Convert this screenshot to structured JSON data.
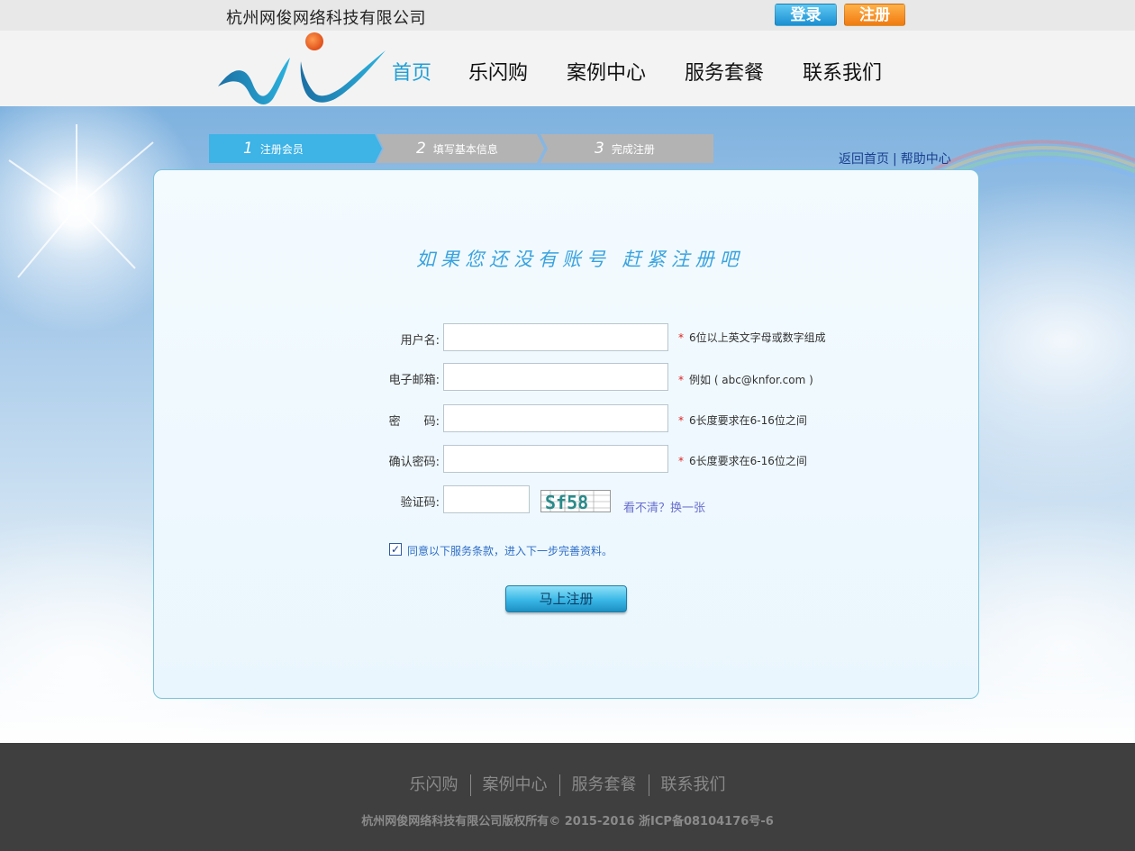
{
  "topbar": {
    "company_name": "杭州网俊网络科技有限公司",
    "login_label": "登录",
    "register_label": "注册"
  },
  "nav": {
    "items": [
      {
        "label": "首页",
        "active": true
      },
      {
        "label": "乐闪购",
        "active": false
      },
      {
        "label": "案例中心",
        "active": false
      },
      {
        "label": "服务套餐",
        "active": false
      },
      {
        "label": "联系我们",
        "active": false
      }
    ]
  },
  "steps": [
    {
      "num": "1",
      "label": "注册会员",
      "active": true
    },
    {
      "num": "2",
      "label": "填写基本信息",
      "active": false
    },
    {
      "num": "3",
      "label": "完成注册",
      "active": false
    }
  ],
  "top_links": {
    "home": "返回首页",
    "separator": "|",
    "help": "帮助中心"
  },
  "slogan": "如果您还没有账号 赶紧注册吧",
  "form": {
    "username": {
      "label": "用户名:",
      "value": "",
      "hint": "6位以上英文字母或数字组成"
    },
    "email": {
      "label": "电子邮箱:",
      "value": "",
      "hint": "例如 ( abc@knfor.com )"
    },
    "password": {
      "label": "密　　码:",
      "value": "",
      "hint": "6长度要求在6-16位之间"
    },
    "confirm": {
      "label": "确认密码:",
      "value": "",
      "hint": "6长度要求在6-16位之间"
    },
    "captcha": {
      "label": "验证码:",
      "value": "",
      "code": "Sf58",
      "refresh": "看不清？换一张"
    },
    "required_mark": "*",
    "agree_text": "同意以下服务条款，进入下一步完善资料。",
    "agree_checked": true,
    "submit_label": "马上注册"
  },
  "footer": {
    "links": [
      "乐闪购",
      "案例中心",
      "服务套餐",
      "联系我们"
    ],
    "copyright": "杭州网俊网络科技有限公司版权所有© 2015-2016 浙ICP备08104176号-6"
  },
  "colors": {
    "accent_blue": "#1f9fd5",
    "register_orange": "#f07a10",
    "footer_bg": "#3f3f3f"
  }
}
